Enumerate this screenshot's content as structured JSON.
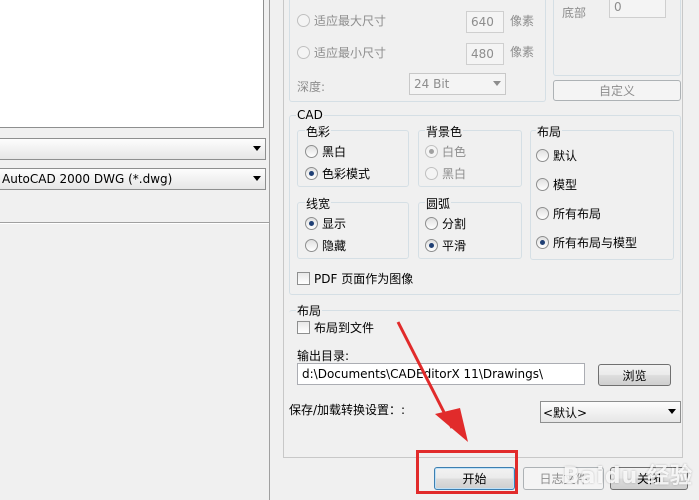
{
  "left": {
    "combo1_value": "",
    "combo2_value": "AutoCAD 2000 DWG (*.dwg)"
  },
  "size": {
    "fit_max_label": "适应最大尺寸",
    "fit_max_value": "640",
    "fit_min_label": "适应最小尺寸",
    "fit_min_value": "480",
    "pixel_unit": "像素",
    "depth_label": "深度:",
    "depth_value": "24 Bit",
    "bottom_label": "底部",
    "bottom_value": "0",
    "custom_button": "自定义"
  },
  "cad": {
    "title": "CAD",
    "color": {
      "title": "色彩",
      "bw": "黑白",
      "color_mode": "色彩模式",
      "selected": "color_mode"
    },
    "bg": {
      "title": "背景色",
      "white": "白色",
      "black": "黑白",
      "selected": "white"
    },
    "layout": {
      "title": "布局",
      "default": "默认",
      "model": "模型",
      "all_layouts": "所有布局",
      "all_layouts_model": "所有布局与模型",
      "selected": "all_layouts_model"
    },
    "linewidth": {
      "title": "线宽",
      "show": "显示",
      "hide": "隐藏",
      "selected": "show"
    },
    "arc": {
      "title": "圆弧",
      "split": "分割",
      "smooth": "平滑",
      "selected": "smooth"
    },
    "pdf_as_image": "PDF 页面作为图像"
  },
  "layout_section": {
    "title": "布局",
    "layout_to_file": "布局到文件"
  },
  "output": {
    "label": "输出目录:",
    "path": "d:\\Documents\\CADEditorX 11\\Drawings\\",
    "browse": "浏览"
  },
  "settings": {
    "label": "保存/加载转换设置：:",
    "value": "<默认>"
  },
  "buttons": {
    "start": "开始",
    "log": "日志文件",
    "close": "关闭"
  },
  "watermark": "Baidu 经验",
  "colors": {
    "highlight_box": "#e12b2b",
    "arrow": "#e12b2b"
  }
}
